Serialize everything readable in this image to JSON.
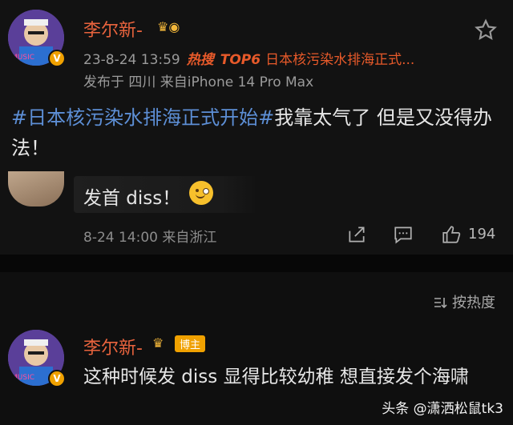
{
  "post": {
    "author_name": "李尔新-",
    "timestamp": "23-8-24 13:59",
    "hot_search_tag": "热搜",
    "top_tag": "TOP6",
    "hot_topic": "日本核污染水排海正式...",
    "location_device": "发布于 四川  来自iPhone 14 Pro Max",
    "hashtag": "#日本核污染水排海正式开始#",
    "text": "我靠太气了 但是又没得办法！"
  },
  "comment": {
    "text": "发首 diss！",
    "meta": "8-24 14:00  来自浙江",
    "like_count": "194"
  },
  "sort_label": "按热度",
  "reply": {
    "author_name": "李尔新-",
    "badge": "博主",
    "text": "这种时候发 diss 显得比较幼稚 想直接发个海啸"
  },
  "watermark": "头条 @潇洒松鼠tk3",
  "colors": {
    "accent_name": "#e8633d",
    "hashtag": "#5d8fd6",
    "hot": "#e85a2a",
    "background": "#121212"
  },
  "icons": [
    "verified-icon",
    "star-icon",
    "share-icon",
    "comment-icon",
    "like-icon",
    "sort-icon",
    "crown-icon"
  ]
}
